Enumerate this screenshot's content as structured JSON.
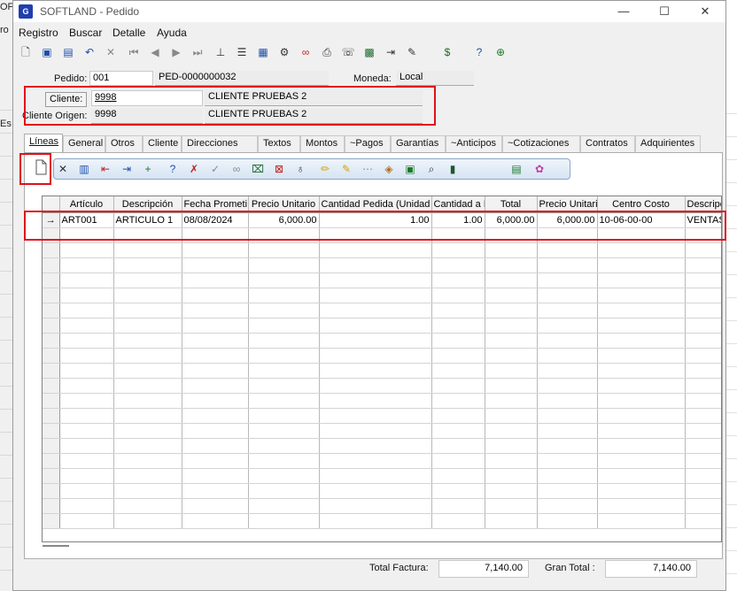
{
  "background": {
    "left_fragments": [
      "OF",
      "ro",
      "Es"
    ]
  },
  "window": {
    "title": "SOFTLAND - Pedido",
    "app_icon_text": "G",
    "controls": {
      "minimize": "—",
      "maximize": "☐",
      "close": "✕"
    }
  },
  "menu": [
    "Registro",
    "Buscar",
    "Detalle",
    "Ayuda"
  ],
  "toolbar_icons": [
    "new-icon",
    "save-icon",
    "save-as-icon",
    "undo-icon",
    "delete-icon",
    "first-record-icon",
    "previous-record-icon",
    "next-record-icon",
    "last-record-icon",
    "stamp-icon",
    "print-preview-icon",
    "calculator-icon",
    "tools-icon",
    "link-icon",
    "printer-icon",
    "fax-icon",
    "chip-icon",
    "export-icon",
    "pin-icon",
    "currency-icon",
    "help-icon",
    "settings-icon"
  ],
  "header": {
    "pedido_label": "Pedido:",
    "pedido_value": "001",
    "pedido_number": "PED-0000000032",
    "moneda_label": "Moneda:",
    "moneda_value": "Local",
    "cliente_label": "Cliente:",
    "cliente_code": "9998",
    "cliente_name": "CLIENTE PRUEBAS 2",
    "cliente_origen_label": "Cliente Origen:",
    "cliente_origen_code": "9998",
    "cliente_origen_name": "CLIENTE PRUEBAS 2"
  },
  "tabs": [
    "Líneas",
    "General",
    "Otros",
    "Cliente",
    "Direcciones",
    "Textos",
    "Montos",
    "~Pagos",
    "Garantías",
    "~Anticipos",
    "~Cotizaciones",
    "Contratos",
    "Adquirientes"
  ],
  "lines_toolbar_icons": [
    "new-line-icon",
    "delete-line-icon",
    "columns-icon",
    "insert-before-icon",
    "insert-after-icon",
    "add-line-icon",
    "help-line-icon",
    "remove-line-icon",
    "approve-icon",
    "link-icon",
    "cut-icon",
    "clear-icon",
    "lightbulb-icon",
    "pencil-icon",
    "edit-icon",
    "dots-icon",
    "package-icon",
    "excel-icon",
    "search-icon",
    "barcode-icon",
    "export-excel-icon",
    "palette-icon"
  ],
  "grid": {
    "columns": [
      "Artículo",
      "Descripción",
      "Fecha Prometi",
      "Precio Unitario",
      "Cantidad Pedida (Unidad A",
      "Cantidad a I",
      "Total",
      "Precio Unitari",
      "Centro Costo",
      "Descripc"
    ],
    "row_marker": "→",
    "rows": [
      [
        "ART001",
        "ARTICULO 1",
        "08/08/2024",
        "6,000.00",
        "1.00",
        "1.00",
        "6,000.00",
        "6,000.00",
        "10-06-00-00",
        "VENTAS"
      ]
    ],
    "empty_rows": 20
  },
  "totals": {
    "total_factura_label": "Total Factura:",
    "total_factura_value": "7,140.00",
    "gran_total_label": "Gran Total :",
    "gran_total_value": "7,140.00"
  },
  "colors": {
    "highlight_red": "#e0101a",
    "title_text": "#555555",
    "app_icon": "#1f3fae"
  }
}
